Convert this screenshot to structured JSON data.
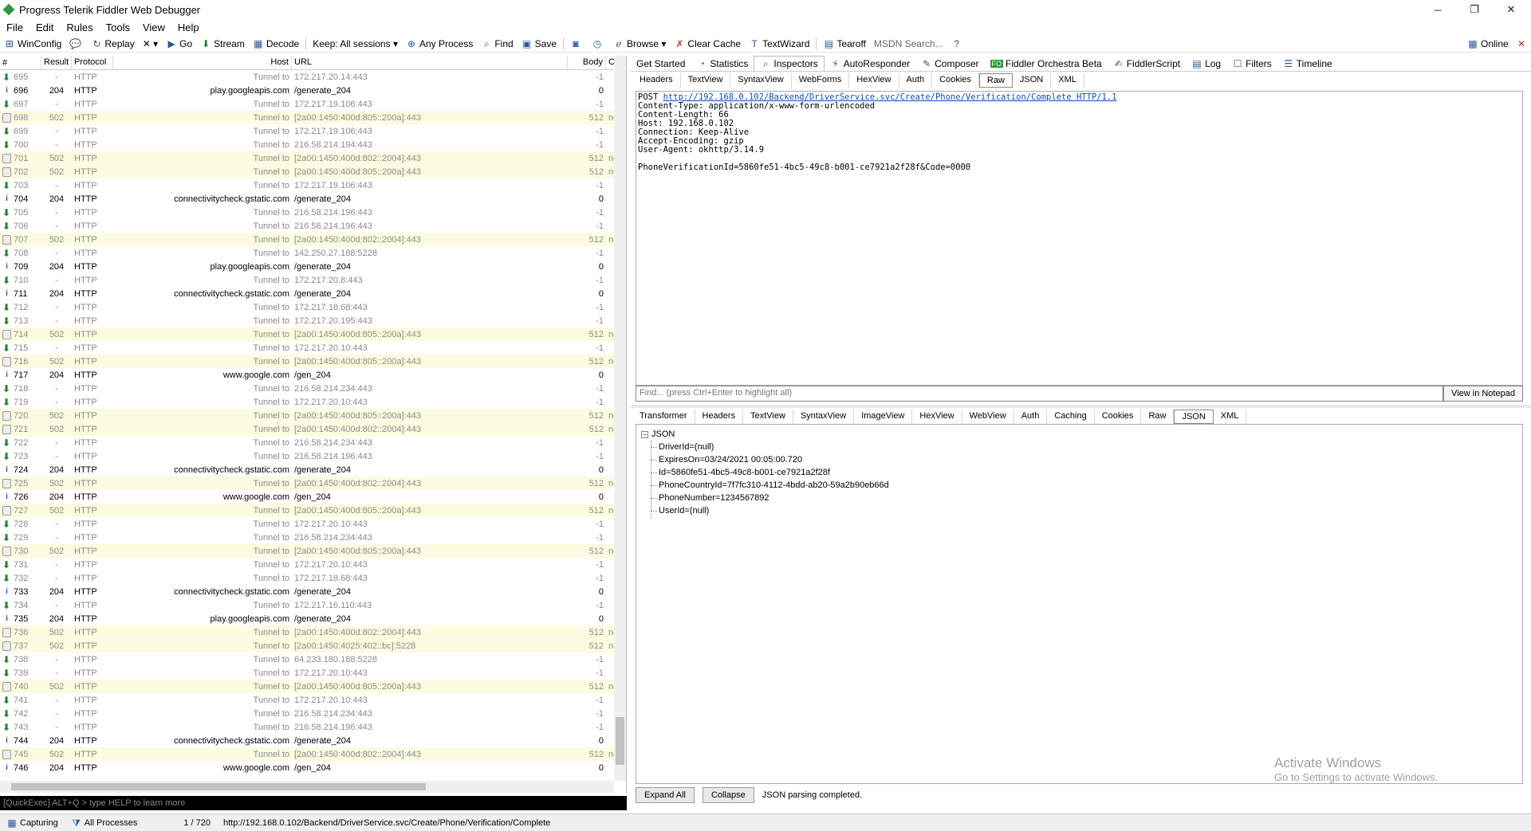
{
  "window": {
    "title": "Progress Telerik Fiddler Web Debugger",
    "minimize": "─",
    "maximize": "❐",
    "close": "✕"
  },
  "menu": [
    "File",
    "Edit",
    "Rules",
    "Tools",
    "View",
    "Help"
  ],
  "toolbar": {
    "winconfig": "WinConfig",
    "replay": "Replay",
    "remove": "✕ ▾",
    "go": "Go",
    "stream": "Stream",
    "decode": "Decode",
    "keep": "Keep: All sessions ▾",
    "any_process": "Any Process",
    "find": "Find",
    "save": "Save",
    "browse": "Browse ▾",
    "clear_cache": "Clear Cache",
    "textwizard": "TextWizard",
    "tearoff": "Tearoff",
    "msdn_search": "MSDN Search...",
    "online": "Online"
  },
  "sessions": {
    "columns": [
      "#",
      "Result",
      "Protocol",
      "Host",
      "URL",
      "Body",
      "Ca"
    ],
    "rows": [
      {
        "n": "695",
        "r": "-",
        "p": "HTTP",
        "h": "Tunnel to",
        "u": "172.217.20.14:443",
        "b": "-1",
        "c": "",
        "t": "tunnel"
      },
      {
        "n": "696",
        "r": "204",
        "p": "HTTP",
        "h": "play.googleapis.com",
        "u": "/generate_204",
        "b": "0",
        "c": "",
        "t": "ok"
      },
      {
        "n": "697",
        "r": "-",
        "p": "HTTP",
        "h": "Tunnel to",
        "u": "172.217.19.106:443",
        "b": "-1",
        "c": "",
        "t": "tunnel"
      },
      {
        "n": "698",
        "r": "502",
        "p": "HTTP",
        "h": "Tunnel to",
        "u": "[2a00:1450:400d:805::200a]:443",
        "b": "512",
        "c": "no-",
        "t": "err"
      },
      {
        "n": "699",
        "r": "-",
        "p": "HTTP",
        "h": "Tunnel to",
        "u": "172.217.19.106:443",
        "b": "-1",
        "c": "",
        "t": "tunnel"
      },
      {
        "n": "700",
        "r": "-",
        "p": "HTTP",
        "h": "Tunnel to",
        "u": "216.58.214.194:443",
        "b": "-1",
        "c": "",
        "t": "tunnel"
      },
      {
        "n": "701",
        "r": "502",
        "p": "HTTP",
        "h": "Tunnel to",
        "u": "[2a00:1450:400d:802::2004]:443",
        "b": "512",
        "c": "no-",
        "t": "err"
      },
      {
        "n": "702",
        "r": "502",
        "p": "HTTP",
        "h": "Tunnel to",
        "u": "[2a00:1450:400d:805::200a]:443",
        "b": "512",
        "c": "no-",
        "t": "err"
      },
      {
        "n": "703",
        "r": "-",
        "p": "HTTP",
        "h": "Tunnel to",
        "u": "172.217.19.106:443",
        "b": "-1",
        "c": "",
        "t": "tunnel"
      },
      {
        "n": "704",
        "r": "204",
        "p": "HTTP",
        "h": "connectivitycheck.gstatic.com",
        "u": "/generate_204",
        "b": "0",
        "c": "",
        "t": "ok"
      },
      {
        "n": "705",
        "r": "-",
        "p": "HTTP",
        "h": "Tunnel to",
        "u": "216.58.214.196:443",
        "b": "-1",
        "c": "",
        "t": "tunnel"
      },
      {
        "n": "706",
        "r": "-",
        "p": "HTTP",
        "h": "Tunnel to",
        "u": "216.58.214.196:443",
        "b": "-1",
        "c": "",
        "t": "tunnel"
      },
      {
        "n": "707",
        "r": "502",
        "p": "HTTP",
        "h": "Tunnel to",
        "u": "[2a00:1450:400d:802::2004]:443",
        "b": "512",
        "c": "no-",
        "t": "err"
      },
      {
        "n": "708",
        "r": "-",
        "p": "HTTP",
        "h": "Tunnel to",
        "u": "142.250.27.188:5228",
        "b": "-1",
        "c": "",
        "t": "tunnel"
      },
      {
        "n": "709",
        "r": "204",
        "p": "HTTP",
        "h": "play.googleapis.com",
        "u": "/generate_204",
        "b": "0",
        "c": "",
        "t": "ok"
      },
      {
        "n": "710",
        "r": "-",
        "p": "HTTP",
        "h": "Tunnel to",
        "u": "172.217.20.8:443",
        "b": "-1",
        "c": "",
        "t": "tunnel"
      },
      {
        "n": "711",
        "r": "204",
        "p": "HTTP",
        "h": "connectivitycheck.gstatic.com",
        "u": "/generate_204",
        "b": "0",
        "c": "",
        "t": "ok"
      },
      {
        "n": "712",
        "r": "-",
        "p": "HTTP",
        "h": "Tunnel to",
        "u": "172.217.18.68:443",
        "b": "-1",
        "c": "",
        "t": "tunnel"
      },
      {
        "n": "713",
        "r": "-",
        "p": "HTTP",
        "h": "Tunnel to",
        "u": "172.217.20.195:443",
        "b": "-1",
        "c": "",
        "t": "tunnel"
      },
      {
        "n": "714",
        "r": "502",
        "p": "HTTP",
        "h": "Tunnel to",
        "u": "[2a00:1450:400d:805::200a]:443",
        "b": "512",
        "c": "no-",
        "t": "err"
      },
      {
        "n": "715",
        "r": "-",
        "p": "HTTP",
        "h": "Tunnel to",
        "u": "172.217.20.10:443",
        "b": "-1",
        "c": "",
        "t": "tunnel"
      },
      {
        "n": "716",
        "r": "502",
        "p": "HTTP",
        "h": "Tunnel to",
        "u": "[2a00:1450:400d:805::200a]:443",
        "b": "512",
        "c": "no-",
        "t": "err"
      },
      {
        "n": "717",
        "r": "204",
        "p": "HTTP",
        "h": "www.google.com",
        "u": "/gen_204",
        "b": "0",
        "c": "",
        "t": "ok"
      },
      {
        "n": "718",
        "r": "-",
        "p": "HTTP",
        "h": "Tunnel to",
        "u": "216.58.214.234:443",
        "b": "-1",
        "c": "",
        "t": "tunnel"
      },
      {
        "n": "719",
        "r": "-",
        "p": "HTTP",
        "h": "Tunnel to",
        "u": "172.217.20.10:443",
        "b": "-1",
        "c": "",
        "t": "tunnel"
      },
      {
        "n": "720",
        "r": "502",
        "p": "HTTP",
        "h": "Tunnel to",
        "u": "[2a00:1450:400d:805::200a]:443",
        "b": "512",
        "c": "no-",
        "t": "err"
      },
      {
        "n": "721",
        "r": "502",
        "p": "HTTP",
        "h": "Tunnel to",
        "u": "[2a00:1450:400d:802::2004]:443",
        "b": "512",
        "c": "no-",
        "t": "err"
      },
      {
        "n": "722",
        "r": "-",
        "p": "HTTP",
        "h": "Tunnel to",
        "u": "216.58.214.234:443",
        "b": "-1",
        "c": "",
        "t": "tunnel"
      },
      {
        "n": "723",
        "r": "-",
        "p": "HTTP",
        "h": "Tunnel to",
        "u": "216.58.214.196:443",
        "b": "-1",
        "c": "",
        "t": "tunnel"
      },
      {
        "n": "724",
        "r": "204",
        "p": "HTTP",
        "h": "connectivitycheck.gstatic.com",
        "u": "/generate_204",
        "b": "0",
        "c": "",
        "t": "ok"
      },
      {
        "n": "725",
        "r": "502",
        "p": "HTTP",
        "h": "Tunnel to",
        "u": "[2a00:1450:400d:802::2004]:443",
        "b": "512",
        "c": "no-",
        "t": "err"
      },
      {
        "n": "726",
        "r": "204",
        "p": "HTTP",
        "h": "www.google.com",
        "u": "/gen_204",
        "b": "0",
        "c": "",
        "t": "ok"
      },
      {
        "n": "727",
        "r": "502",
        "p": "HTTP",
        "h": "Tunnel to",
        "u": "[2a00:1450:400d:805::200a]:443",
        "b": "512",
        "c": "no-",
        "t": "err"
      },
      {
        "n": "728",
        "r": "-",
        "p": "HTTP",
        "h": "Tunnel to",
        "u": "172.217.20.10:443",
        "b": "-1",
        "c": "",
        "t": "tunnel"
      },
      {
        "n": "729",
        "r": "-",
        "p": "HTTP",
        "h": "Tunnel to",
        "u": "216.58.214.234:443",
        "b": "-1",
        "c": "",
        "t": "tunnel"
      },
      {
        "n": "730",
        "r": "502",
        "p": "HTTP",
        "h": "Tunnel to",
        "u": "[2a00:1450:400d:805::200a]:443",
        "b": "512",
        "c": "no-",
        "t": "err"
      },
      {
        "n": "731",
        "r": "-",
        "p": "HTTP",
        "h": "Tunnel to",
        "u": "172.217.20.10:443",
        "b": "-1",
        "c": "",
        "t": "tunnel"
      },
      {
        "n": "732",
        "r": "-",
        "p": "HTTP",
        "h": "Tunnel to",
        "u": "172.217.18.68:443",
        "b": "-1",
        "c": "",
        "t": "tunnel"
      },
      {
        "n": "733",
        "r": "204",
        "p": "HTTP",
        "h": "connectivitycheck.gstatic.com",
        "u": "/generate_204",
        "b": "0",
        "c": "",
        "t": "ok"
      },
      {
        "n": "734",
        "r": "-",
        "p": "HTTP",
        "h": "Tunnel to",
        "u": "172.217.16.110:443",
        "b": "-1",
        "c": "",
        "t": "tunnel"
      },
      {
        "n": "735",
        "r": "204",
        "p": "HTTP",
        "h": "play.googleapis.com",
        "u": "/generate_204",
        "b": "0",
        "c": "",
        "t": "ok"
      },
      {
        "n": "736",
        "r": "502",
        "p": "HTTP",
        "h": "Tunnel to",
        "u": "[2a00:1450:400d:802::2004]:443",
        "b": "512",
        "c": "no-",
        "t": "err"
      },
      {
        "n": "737",
        "r": "502",
        "p": "HTTP",
        "h": "Tunnel to",
        "u": "[2a00:1450:4025:402::bc]:5228",
        "b": "512",
        "c": "no-",
        "t": "err"
      },
      {
        "n": "738",
        "r": "-",
        "p": "HTTP",
        "h": "Tunnel to",
        "u": "64.233.180.188:5228",
        "b": "-1",
        "c": "",
        "t": "tunnel"
      },
      {
        "n": "739",
        "r": "-",
        "p": "HTTP",
        "h": "Tunnel to",
        "u": "172.217.20.10:443",
        "b": "-1",
        "c": "",
        "t": "tunnel"
      },
      {
        "n": "740",
        "r": "502",
        "p": "HTTP",
        "h": "Tunnel to",
        "u": "[2a00:1450:400d:805::200a]:443",
        "b": "512",
        "c": "no-",
        "t": "err"
      },
      {
        "n": "741",
        "r": "-",
        "p": "HTTP",
        "h": "Tunnel to",
        "u": "172.217.20.10:443",
        "b": "-1",
        "c": "",
        "t": "tunnel"
      },
      {
        "n": "742",
        "r": "-",
        "p": "HTTP",
        "h": "Tunnel to",
        "u": "216.58.214.234:443",
        "b": "-1",
        "c": "",
        "t": "tunnel"
      },
      {
        "n": "743",
        "r": "-",
        "p": "HTTP",
        "h": "Tunnel to",
        "u": "216.58.214.196:443",
        "b": "-1",
        "c": "",
        "t": "tunnel"
      },
      {
        "n": "744",
        "r": "204",
        "p": "HTTP",
        "h": "connectivitycheck.gstatic.com",
        "u": "/generate_204",
        "b": "0",
        "c": "",
        "t": "ok"
      },
      {
        "n": "745",
        "r": "502",
        "p": "HTTP",
        "h": "Tunnel to",
        "u": "[2a00:1450:400d:802::2004]:443",
        "b": "512",
        "c": "no-",
        "t": "err"
      },
      {
        "n": "746",
        "r": "204",
        "p": "HTTP",
        "h": "www.google.com",
        "u": "/gen_204",
        "b": "0",
        "c": "",
        "t": "ok"
      }
    ]
  },
  "quickexec_placeholder": "[QuickExec] ALT+Q > type HELP to learn more",
  "status": {
    "capturing": "Capturing",
    "processes": "All Processes",
    "count": "1 / 720",
    "url": "http://192.168.0.102/Backend/DriverService.svc/Create/Phone/Verification/Complete"
  },
  "top_tabs": [
    "Get Started",
    "Statistics",
    "Inspectors",
    "AutoResponder",
    "Composer",
    "Fiddler Orchestra Beta",
    "FiddlerScript",
    "Log",
    "Filters",
    "Timeline"
  ],
  "fo_badge": "FO",
  "request_tabs": [
    "Headers",
    "TextView",
    "SyntaxView",
    "WebForms",
    "HexView",
    "Auth",
    "Cookies",
    "Raw",
    "JSON",
    "XML"
  ],
  "request": {
    "method": "POST ",
    "url": "http://192.168.0.102/Backend/DriverService.svc/Create/Phone/Verification/Complete HTTP/1.1",
    "headers": "Content-Type: application/x-www-form-urlencoded\nContent-Length: 66\nHost: 192.168.0.102\nConnection: Keep-Alive\nAccept-Encoding: gzip\nUser-Agent: okhttp/3.14.9\n\nPhoneVerificationId=5860fe51-4bc5-49c8-b001-ce7921a2f28f&Code=0000"
  },
  "find": {
    "placeholder": "Find... (press Ctrl+Enter to highlight all)",
    "notepad": "View in Notepad"
  },
  "response_tabs": [
    "Transformer",
    "Headers",
    "TextView",
    "SyntaxView",
    "ImageView",
    "HexView",
    "WebView",
    "Auth",
    "Caching",
    "Cookies",
    "Raw",
    "JSON",
    "XML"
  ],
  "json_tree": {
    "root": "JSON",
    "items": [
      "DriverId=(null)",
      "ExpiresOn=03/24/2021 00:05:00.720",
      "Id=5860fe51-4bc5-49c8-b001-ce7921a2f28f",
      "PhoneCountryId=7f7fc310-4112-4bdd-ab20-59a2b90eb66d",
      "PhoneNumber=1234567892",
      "UserId=(null)"
    ]
  },
  "response_buttons": {
    "expand": "Expand All",
    "collapse": "Collapse",
    "status": "JSON parsing completed."
  },
  "watermark": {
    "line1": "Activate Windows",
    "line2": "Go to Settings to activate Windows."
  }
}
